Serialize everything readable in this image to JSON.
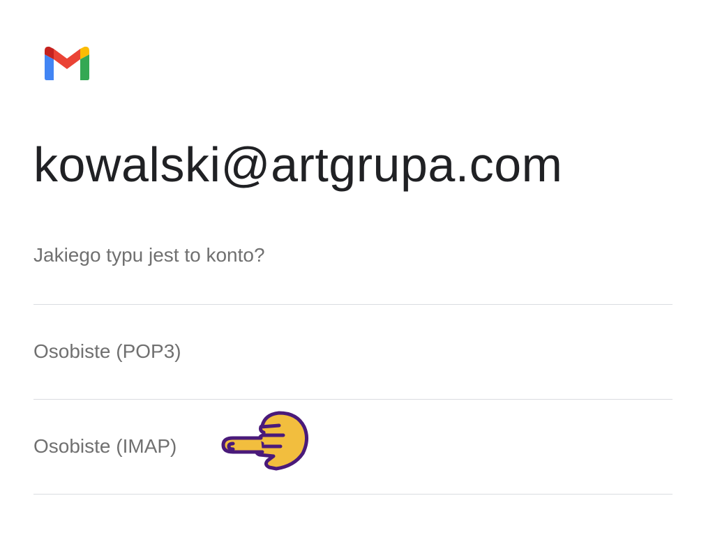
{
  "app": {
    "logo_icon": "gmail-logo-icon",
    "brand_colors": {
      "red": "#EA4335",
      "blue": "#4285F4",
      "green": "#34A853",
      "yellow": "#FBBC04",
      "dark_red": "#C5221F"
    }
  },
  "account": {
    "email": "kowalski@artgrupa.com"
  },
  "prompt": {
    "question": "Jakiego typu jest to konto?"
  },
  "options": [
    {
      "label": "Osobiste (POP3)"
    },
    {
      "label": "Osobiste (IMAP)"
    }
  ],
  "annotation": {
    "icon": "pointing-hand-icon",
    "colors": {
      "fill": "#F2BE3E",
      "outline": "#4A1A7A"
    }
  }
}
